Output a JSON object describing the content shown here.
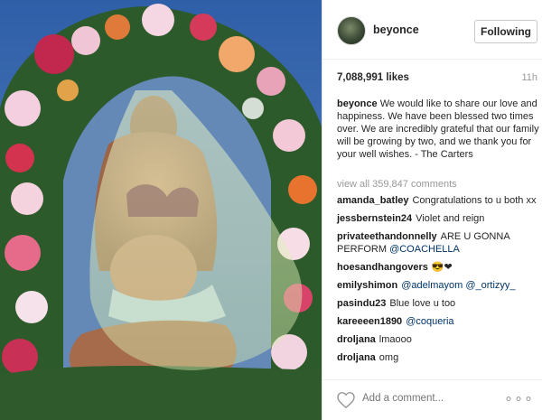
{
  "header": {
    "username": "beyonce",
    "follow_label": "Following"
  },
  "post": {
    "likes": "7,088,991 likes",
    "age": "11h",
    "caption_user": "beyonce",
    "caption_text": "We would like to share our love and happiness. We have been blessed two times over. We are incredibly grateful that our family will be growing by two, and we thank you for your well wishes. - The Carters",
    "view_all": "view all 359,847 comments"
  },
  "comments": [
    {
      "user": "amanda_batley",
      "text": "Congratulations to u both xx",
      "mention": ""
    },
    {
      "user": "jessbernstein24",
      "text": "Violet and reign",
      "mention": ""
    },
    {
      "user": "privateethandonnelly",
      "text": "ARE U GONNA PERFORM",
      "mention": "@COACHELLA"
    },
    {
      "user": "hoesandhangovers",
      "text": "😎❤",
      "mention": ""
    },
    {
      "user": "emilyshimon",
      "text": "",
      "mention": "@adelmayom @_ortizyy_"
    },
    {
      "user": "pasindu23",
      "text": "Blue love u too",
      "mention": ""
    },
    {
      "user": "kareeeen1890",
      "text": "",
      "mention": "@coqueria"
    },
    {
      "user": "droljana",
      "text": "lmaooo",
      "mention": ""
    },
    {
      "user": "droljana",
      "text": "omg",
      "mention": ""
    }
  ],
  "footer": {
    "add_comment_placeholder": "Add a comment...",
    "more_glyph": "∘∘∘"
  },
  "colors": {
    "sky": "#3f6db0",
    "mention": "#003569",
    "muted": "#999999"
  }
}
